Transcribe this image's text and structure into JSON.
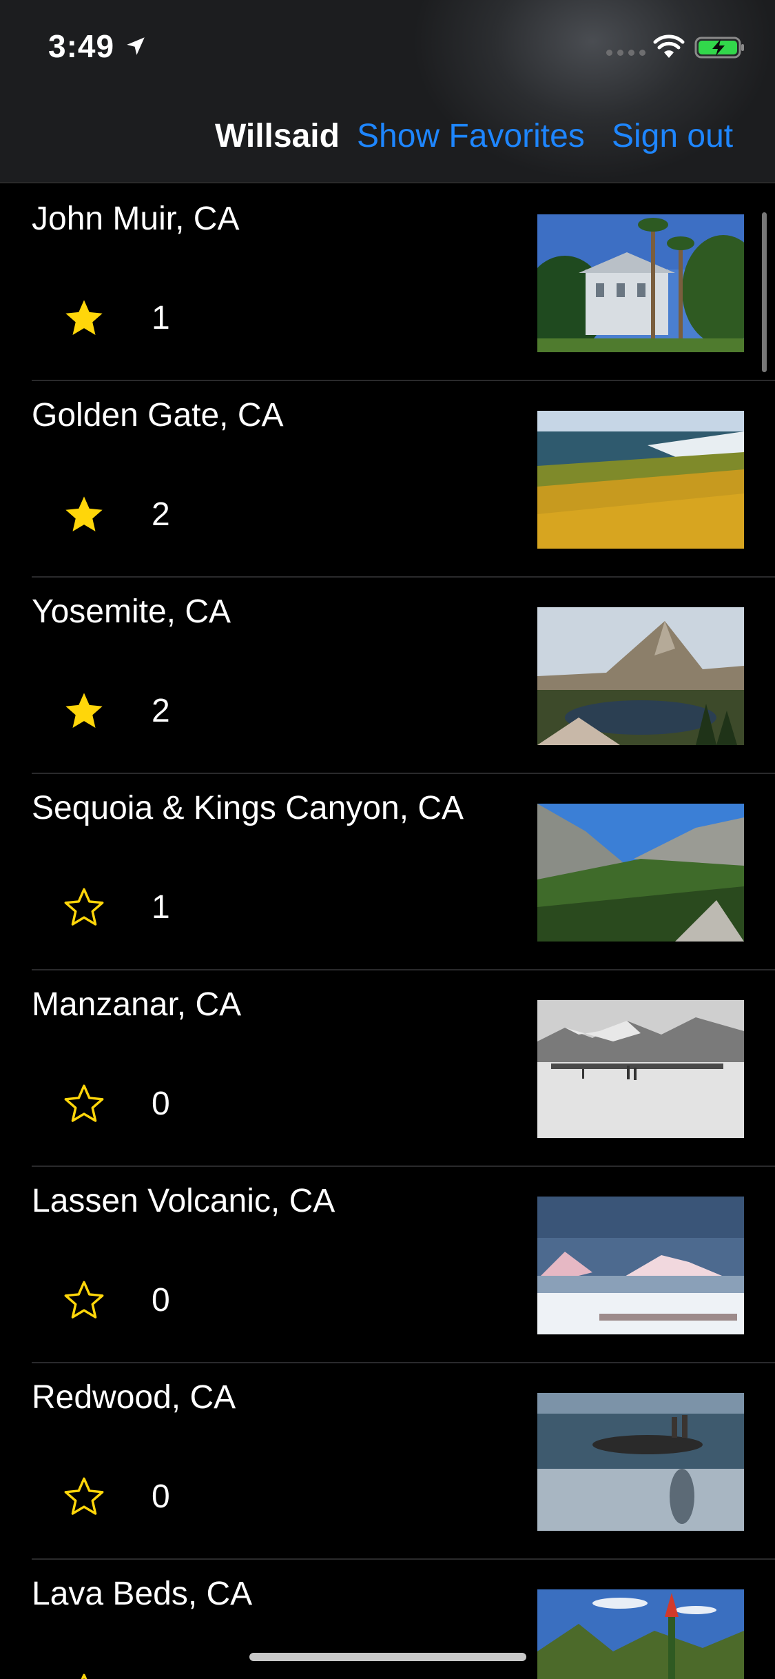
{
  "status_bar": {
    "time": "3:49",
    "location_icon": "location-arrow-icon",
    "wifi_icon": "wifi-icon",
    "battery_icon": "battery-charging-icon"
  },
  "nav": {
    "user": "Willsaid",
    "show_favorites": "Show Favorites",
    "sign_out": "Sign out",
    "link_color": "#1e86ff"
  },
  "parks": [
    {
      "name": "John Muir, CA",
      "favorite": true,
      "count": "1"
    },
    {
      "name": "Golden Gate, CA",
      "favorite": true,
      "count": "2"
    },
    {
      "name": "Yosemite, CA",
      "favorite": true,
      "count": "2"
    },
    {
      "name": "Sequoia & Kings Canyon, CA",
      "favorite": false,
      "count": "1"
    },
    {
      "name": "Manzanar, CA",
      "favorite": false,
      "count": "0"
    },
    {
      "name": "Lassen Volcanic, CA",
      "favorite": false,
      "count": "0"
    },
    {
      "name": "Redwood, CA",
      "favorite": false,
      "count": "0"
    },
    {
      "name": "Lava Beds, CA",
      "favorite": false,
      "count": ""
    }
  ],
  "colors": {
    "star": "#ffd60a",
    "background": "#000000",
    "separator": "#2a2a2c"
  }
}
